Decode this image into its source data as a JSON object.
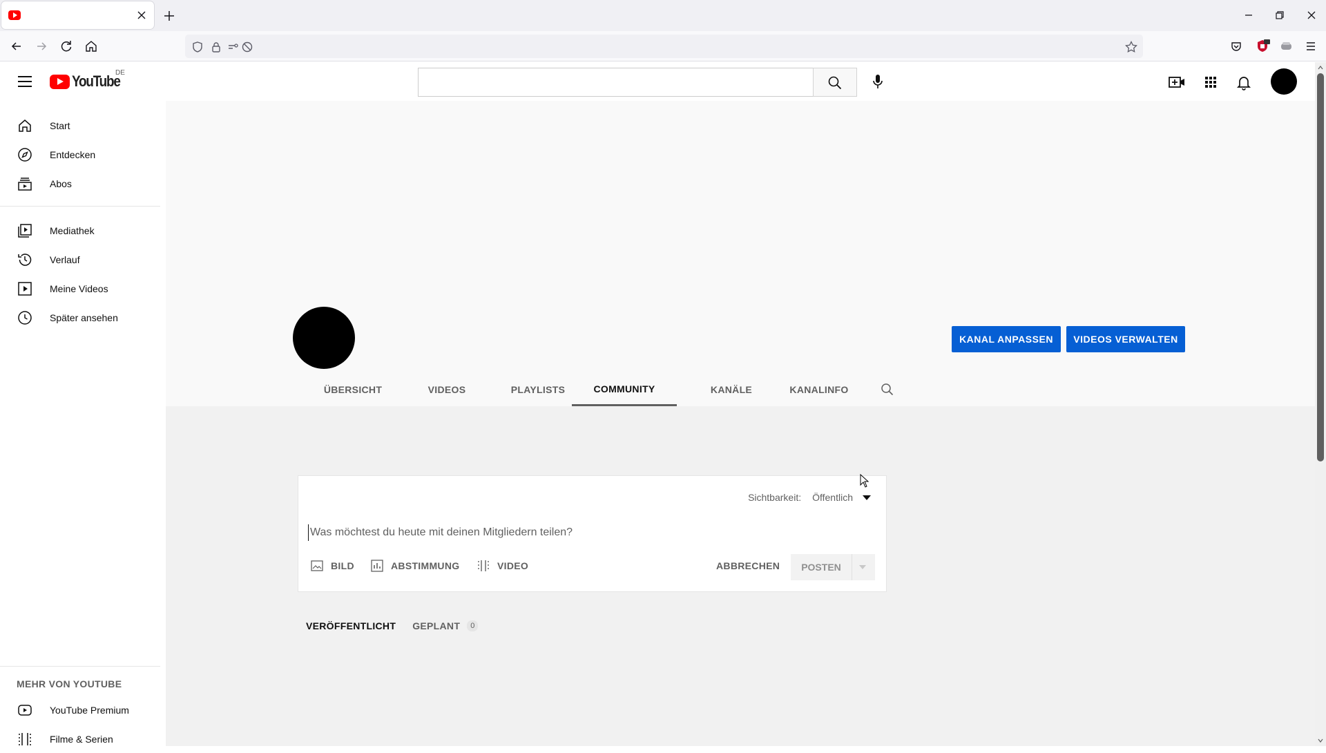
{
  "browser": {
    "tab": {
      "title": "",
      "favicon": "youtube-favicon"
    },
    "window_controls": [
      "minimize",
      "restore",
      "close"
    ],
    "address": {
      "value": ""
    }
  },
  "youtube": {
    "logo_text": "YouTube",
    "country_code": "DE",
    "search": {
      "value": "",
      "placeholder": ""
    }
  },
  "sidebar": {
    "primary": [
      {
        "label": "Start",
        "icon": "home-icon"
      },
      {
        "label": "Entdecken",
        "icon": "compass-icon"
      },
      {
        "label": "Abos",
        "icon": "subscriptions-icon"
      }
    ],
    "library": [
      {
        "label": "Mediathek",
        "icon": "library-icon"
      },
      {
        "label": "Verlauf",
        "icon": "history-icon"
      },
      {
        "label": "Meine Videos",
        "icon": "my-videos-icon"
      },
      {
        "label": "Später ansehen",
        "icon": "watch-later-icon"
      }
    ],
    "more_title": "MEHR VON YOUTUBE",
    "more": [
      {
        "label": "YouTube Premium",
        "icon": "youtube-premium-icon"
      },
      {
        "label": "Filme & Serien",
        "icon": "movies-icon"
      }
    ]
  },
  "channel": {
    "buttons": {
      "customize": "KANAL ANPASSEN",
      "manage": "VIDEOS VERWALTEN"
    },
    "tabs": [
      "ÜBERSICHT",
      "VIDEOS",
      "PLAYLISTS",
      "COMMUNITY",
      "KANÄLE",
      "KANALINFO"
    ],
    "active_tab": "COMMUNITY"
  },
  "post": {
    "visibility_label": "Sichtbarkeit:",
    "visibility_value": "Öffentlich",
    "placeholder": "Was möchtest du heute mit deinen Mitgliedern teilen?",
    "actions": {
      "image": "BILD",
      "poll": "ABSTIMMUNG",
      "video": "VIDEO"
    },
    "cancel": "ABBRECHEN",
    "submit": "POSTEN"
  },
  "feed_tabs": {
    "published": "VERÖFFENTLICHT",
    "scheduled": "GEPLANT",
    "scheduled_count": "0"
  },
  "colors": {
    "brand_red": "#ff0000",
    "primary_blue": "#065fd4"
  }
}
